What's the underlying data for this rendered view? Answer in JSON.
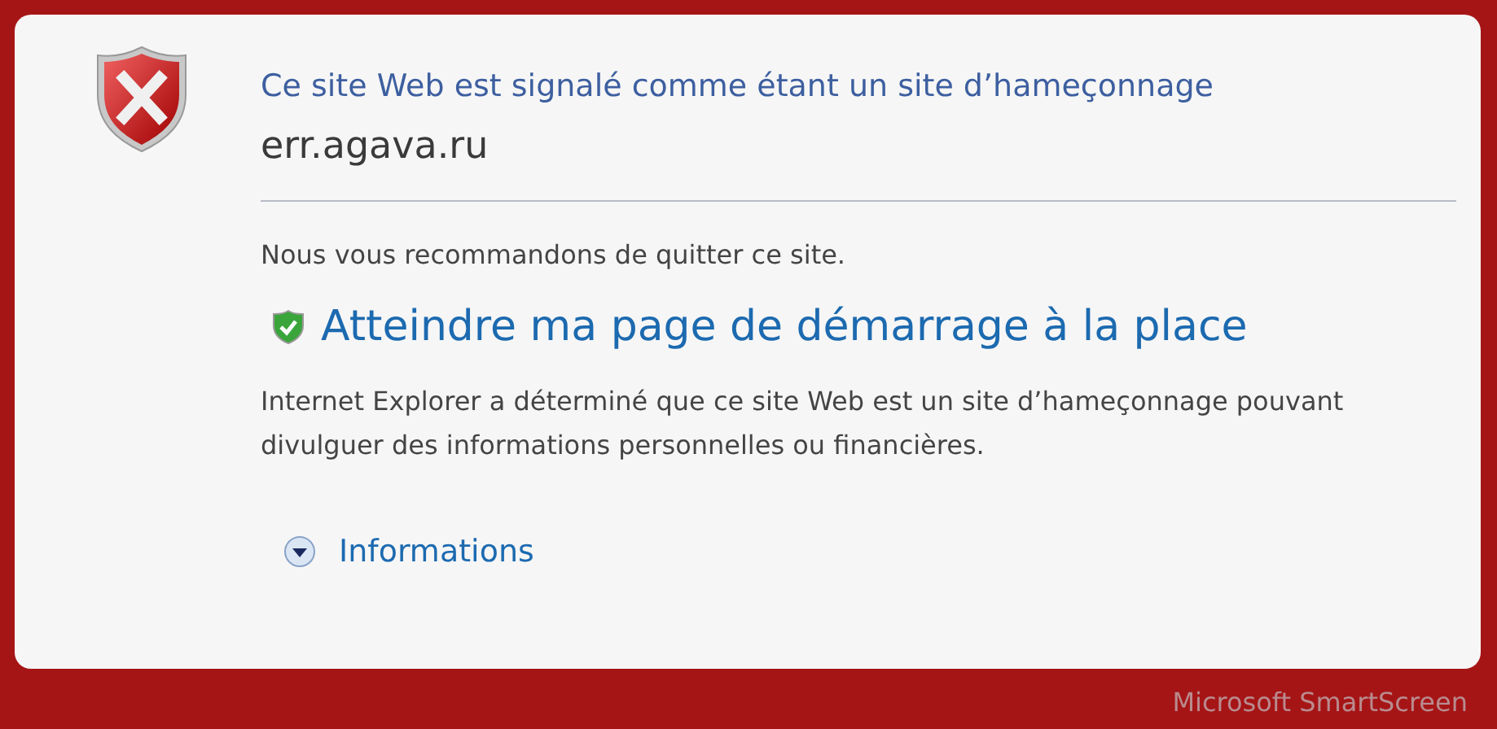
{
  "title": "Ce site Web est signalé comme étant un site d’hameçonnage",
  "site": "err.agava.ru",
  "recommendation": "Nous vous recommandons de quitter ce site.",
  "home_link": "Atteindre ma page de démarrage à la place",
  "explanation": "Internet Explorer a déterminé que ce site Web est un site d’hameçonnage pouvant divulguer des informations personnelles ou financières.",
  "more_info": {
    "label": "Informations",
    "expanded": false
  },
  "footer": "Microsoft SmartScreen"
}
